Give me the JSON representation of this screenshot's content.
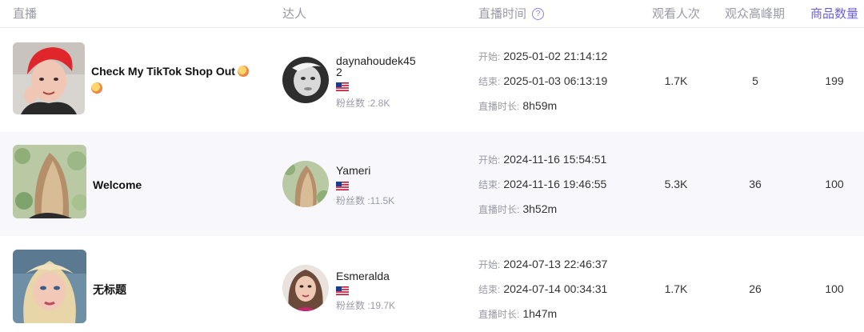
{
  "header": {
    "live": "直播",
    "creator": "达人",
    "live_time": "直播时间",
    "help_icon": "question-circle-icon",
    "views": "观看人次",
    "peak": "观众高峰期",
    "products": "商品数量"
  },
  "labels": {
    "start": "开始:",
    "end": "结束:",
    "duration": "直播时长:"
  },
  "rows": [
    {
      "title": "Check My TikTok Shop Out",
      "creator_name_line1": "daynahoudek45",
      "creator_name_line2": "2",
      "fans": "粉丝数 :2.8K",
      "start": "2025-01-02 21:14:12",
      "end": "2025-01-03 06:13:19",
      "duration": "8h59m",
      "views": "1.7K",
      "peak": "5",
      "products": "199"
    },
    {
      "title": "Welcome",
      "creator_name_line1": "Yameri",
      "fans": "粉丝数 :11.5K",
      "start": "2024-11-16 15:54:51",
      "end": "2024-11-16 19:46:55",
      "duration": "3h52m",
      "views": "5.3K",
      "peak": "36",
      "products": "100"
    },
    {
      "title": "无标题",
      "creator_name_line1": "Esmeralda",
      "fans": "粉丝数 :19.7K",
      "start": "2024-07-13 22:46:37",
      "end": "2024-07-14 00:34:31",
      "duration": "1h47m",
      "views": "1.7K",
      "peak": "26",
      "products": "100"
    }
  ],
  "colors": {
    "accent": "#6a5fe0",
    "muted": "#9a9aa6",
    "alt_row": "#f8f8fc"
  }
}
